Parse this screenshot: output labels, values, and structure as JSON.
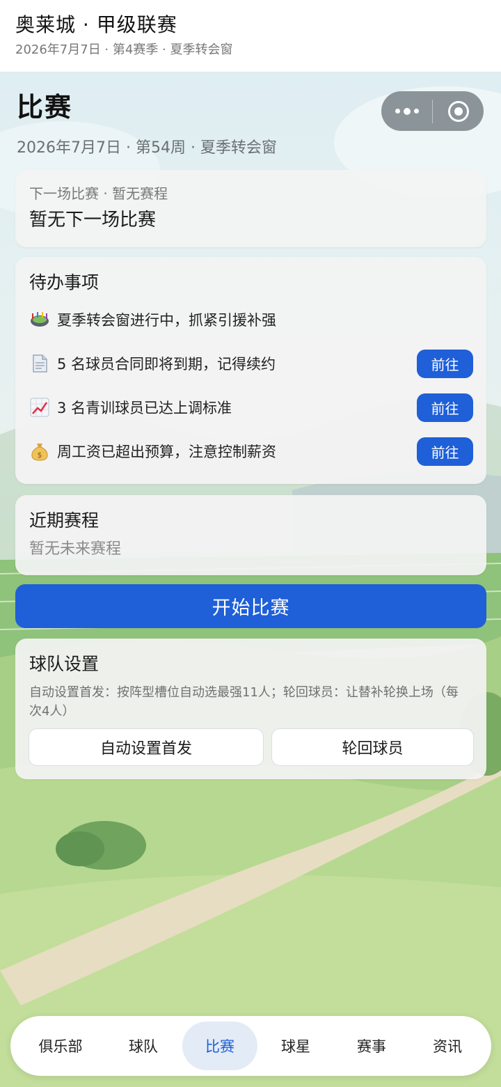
{
  "header": {
    "title": "奥莱城 · 甲级联赛",
    "subtitle": "2026年7月7日 · 第4赛季 · 夏季转会窗"
  },
  "page": {
    "title": "比赛",
    "subtitle": "2026年7月7日 · 第54周 · 夏季转会窗"
  },
  "capsule": {
    "more_icon": "more-dots-icon",
    "close_icon": "target-icon"
  },
  "next_match": {
    "label": "下一场比赛 · 暂无赛程",
    "value": "暂无下一场比赛"
  },
  "todo": {
    "title": "待办事项",
    "items": [
      {
        "icon": "stadium-icon",
        "text": "夏季转会窗进行中，抓紧引援补强",
        "button": ""
      },
      {
        "icon": "document-icon",
        "text": "5 名球员合同即将到期，记得续约",
        "button": "前往"
      },
      {
        "icon": "chart-up-icon",
        "text": "3 名青训球员已达上调标准",
        "button": "前往"
      },
      {
        "icon": "money-bag-icon",
        "text": "周工资已超出预算，注意控制薪资",
        "button": "前往"
      }
    ]
  },
  "fixtures": {
    "title": "近期赛程",
    "empty": "暂无未来赛程"
  },
  "start_button": "开始比赛",
  "settings": {
    "title": "球队设置",
    "description": "自动设置首发：按阵型槽位自动选最强11人；轮回球员：让替补轮换上场（每次4人）",
    "auto_lineup": "自动设置首发",
    "rotate": "轮回球员"
  },
  "tabs": [
    {
      "label": "俱乐部",
      "active": false
    },
    {
      "label": "球队",
      "active": false
    },
    {
      "label": "比赛",
      "active": true
    },
    {
      "label": "球星",
      "active": false
    },
    {
      "label": "赛事",
      "active": false
    },
    {
      "label": "资讯",
      "active": false
    }
  ],
  "colors": {
    "accent": "#1f5fd8",
    "tab_active_bg": "#e3ebf7"
  }
}
